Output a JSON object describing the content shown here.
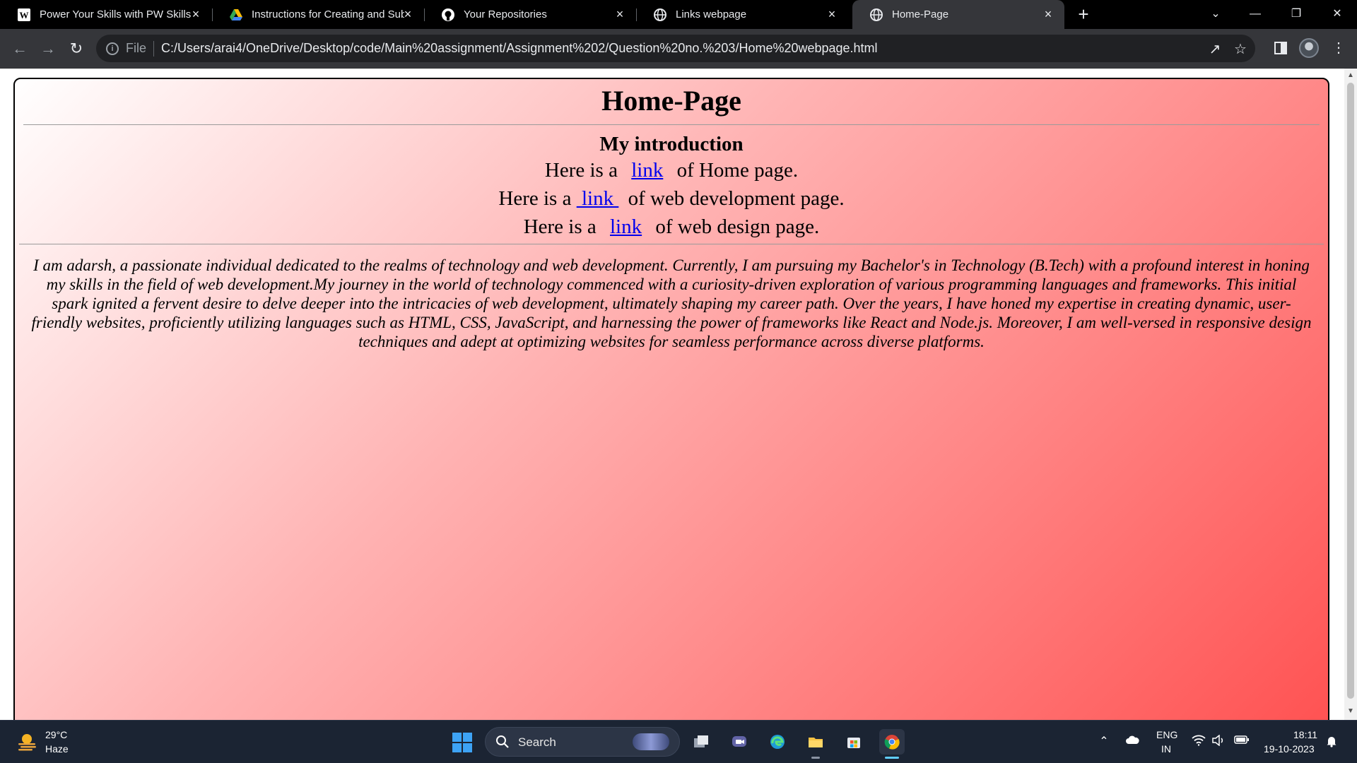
{
  "browser": {
    "tabs": [
      {
        "title": "Power Your Skills with PW Skills",
        "favicon": "wordpress-icon",
        "active": false
      },
      {
        "title": "Instructions for Creating and Sub",
        "favicon": "google-drive-icon",
        "active": false
      },
      {
        "title": "Your Repositories",
        "favicon": "github-icon",
        "active": false
      },
      {
        "title": "Links webpage",
        "favicon": "globe-icon",
        "active": false
      },
      {
        "title": "Home-Page",
        "favicon": "globe-icon",
        "active": true
      }
    ],
    "close_glyph": "×",
    "new_tab_glyph": "+",
    "address": {
      "scheme_label": "File",
      "url": "C:/Users/arai4/OneDrive/Desktop/code/Main%20assignment/Assignment%202/Question%20no.%203/Home%20webpage.html"
    }
  },
  "page": {
    "title": "Home-Page",
    "intro_heading": "My introduction",
    "links": [
      {
        "prefix": "Here is a ",
        "link_text": "link",
        "suffix": " of Home page."
      },
      {
        "prefix": "Here is a ",
        "link_text": " link ",
        "suffix": " of web development page."
      },
      {
        "prefix": "Here is a ",
        "link_text": "link",
        "suffix": " of web design page."
      }
    ],
    "paragraph": "I am adarsh, a passionate individual dedicated to the realms of technology and web development. Currently, I am pursuing my Bachelor's in Technology (B.Tech) with a profound interest in honing my skills in the field of web development.My journey in the world of technology commenced with a curiosity-driven exploration of various programming languages and frameworks. This initial spark ignited a fervent desire to delve deeper into the intricacies of web development, ultimately shaping my career path. Over the years, I have honed my expertise in creating dynamic, user-friendly websites, proficiently utilizing languages such as HTML, CSS, JavaScript, and harnessing the power of frameworks like React and Node.js. Moreover, I am well-versed in responsive design techniques and adept at optimizing websites for seamless performance across diverse platforms.",
    "colors": {
      "gradient_start": "#ffffff",
      "gradient_end": "#ff5050",
      "link": "#0000ee"
    }
  },
  "taskbar": {
    "weather": {
      "temp": "29°C",
      "condition": "Haze"
    },
    "search_label": "Search",
    "apps": [
      "windows-start-icon",
      "task-view-icon",
      "teams-chat-icon",
      "edge-icon",
      "file-explorer-icon",
      "microsoft-store-icon",
      "chrome-icon"
    ],
    "language": {
      "line1": "ENG",
      "line2": "IN"
    },
    "clock": {
      "time": "18:11",
      "date": "19-10-2023"
    }
  }
}
